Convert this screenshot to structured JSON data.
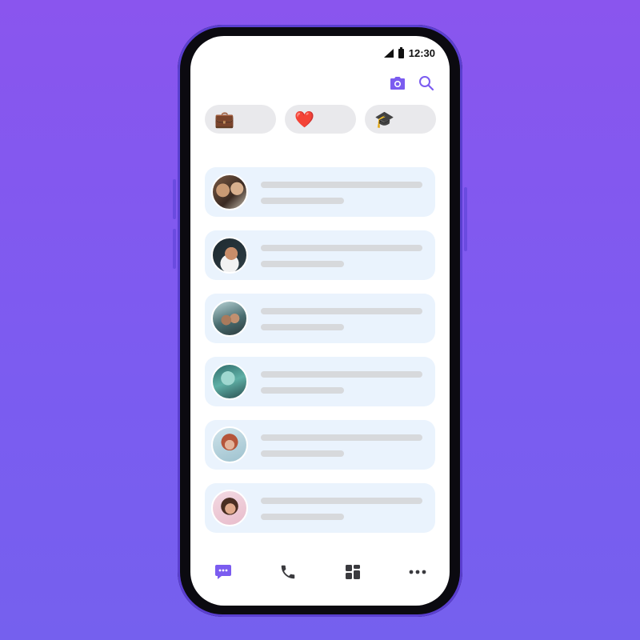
{
  "status_bar": {
    "time": "12:30"
  },
  "toolbar": {
    "camera_icon": "camera-icon",
    "search_icon": "search-icon"
  },
  "chips": [
    {
      "emoji": "💼",
      "icon": "briefcase-icon"
    },
    {
      "emoji": "❤️",
      "icon": "heart-icon"
    },
    {
      "emoji": "🎓",
      "icon": "graduation-cap-icon"
    }
  ],
  "conversations": [
    {
      "avatar": "group-selfie"
    },
    {
      "avatar": "bearded-man"
    },
    {
      "avatar": "couple"
    },
    {
      "avatar": "teal-photo"
    },
    {
      "avatar": "red-haired-woman"
    },
    {
      "avatar": "brunette-woman"
    }
  ],
  "nav": [
    {
      "icon": "chat-icon",
      "active": true
    },
    {
      "icon": "phone-icon",
      "active": false
    },
    {
      "icon": "grid-icon",
      "active": false
    },
    {
      "icon": "more-icon",
      "active": false
    }
  ],
  "colors": {
    "accent": "#7b5cf0",
    "row_bg": "#eaf3fd",
    "chip_bg": "#e9e9ec",
    "placeholder": "#d7d9dc"
  }
}
